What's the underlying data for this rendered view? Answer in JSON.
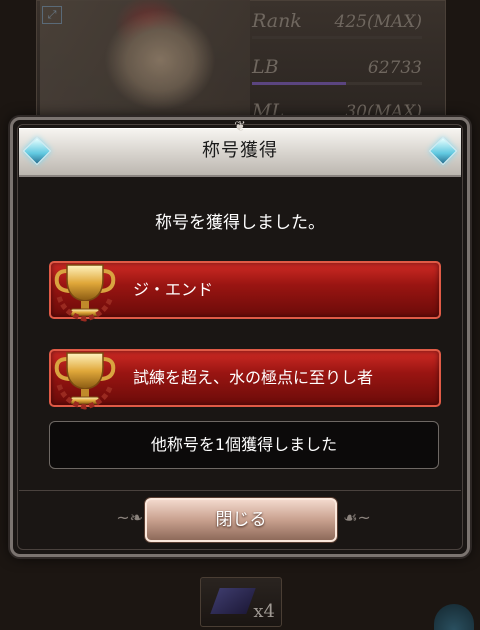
{
  "background": {
    "stats": [
      {
        "label": "Rank",
        "value": "425(MAX)"
      },
      {
        "label": "LB",
        "value": "62733"
      },
      {
        "label": "ML",
        "value": "30(MAX)"
      }
    ],
    "lb_progress": 0.55,
    "bottom_item_count": "x4"
  },
  "modal": {
    "title": "称号獲得",
    "subtitle": "称号を獲得しました。",
    "titles": [
      {
        "label": "ジ・エンド",
        "icon": "trophy-icon"
      },
      {
        "label": "試練を超え、水の極点に至りし者",
        "icon": "trophy-icon"
      }
    ],
    "more_titles_text": "他称号を1個獲得しました",
    "close_label": "閉じる"
  },
  "colors": {
    "title_row_red": "#9a1512",
    "header_silver": "#d6d2cc",
    "gem_blue": "#60c8e0"
  }
}
